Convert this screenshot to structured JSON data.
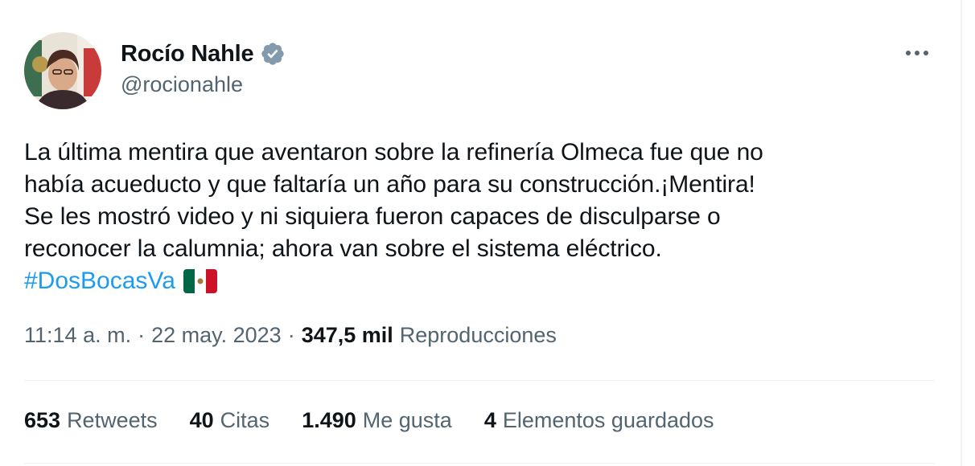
{
  "author": {
    "display_name": "Rocío Nahle",
    "handle": "@rocionahle",
    "verified_icon": "verified-badge-icon"
  },
  "tweet": {
    "text": "La última mentira que aventaron sobre la refinería Olmeca fue que no\nhabía acueducto y que faltaría un año para su construcción.¡Mentira!\nSe les mostró video y ni siquiera fueron capaces de disculparse o\nreconocer la calumnia; ahora van sobre el sistema eléctrico.",
    "hashtag": "#DosBocasVa",
    "emoji": "mexico-flag-icon"
  },
  "meta": {
    "time": "11:14 a. m.",
    "separator": "·",
    "date": "22 may. 2023",
    "views_count": "347,5 mil",
    "views_label": "Reproducciones"
  },
  "stats": {
    "retweets_count": "653",
    "retweets_label": "Retweets",
    "quotes_count": "40",
    "quotes_label": "Citas",
    "likes_count": "1.490",
    "likes_label": "Me gusta",
    "bookmarks_count": "4",
    "bookmarks_label": "Elementos guardados"
  },
  "colors": {
    "link": "#1d9bf0",
    "secondary_text": "#536471",
    "verified": "#829aab"
  }
}
